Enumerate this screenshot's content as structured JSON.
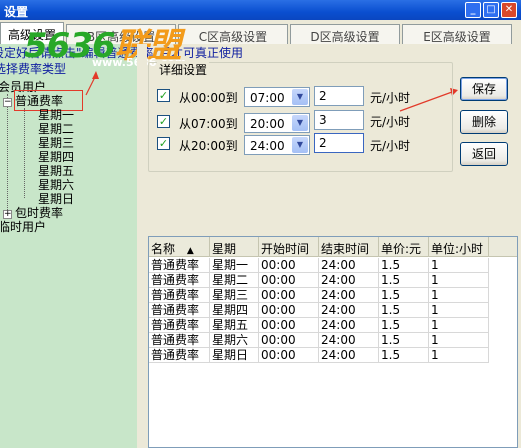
{
  "window": {
    "title": "设置"
  },
  "tabs": [
    {
      "label": "高级设置"
    },
    {
      "label": "B区高级设置"
    },
    {
      "label": "C区高级设置"
    },
    {
      "label": "D区高级设置"
    },
    {
      "label": "E区高级设置"
    }
  ],
  "hint": {
    "line1": "设定好后请点击\"编辑普通费率\"后才可真正使用",
    "line2": "选择费率类型"
  },
  "watermark": {
    "text_g": "5636",
    "text_o": "联盟",
    "url": "www.5636.com"
  },
  "tree": {
    "root_member": "会员用户",
    "node_normal": "普通费率",
    "days": [
      "星期一",
      "星期二",
      "星期三",
      "星期四",
      "星期五",
      "星期六",
      "星期日"
    ],
    "node_hourly": "包时费率",
    "root_temp": "临时用户"
  },
  "details": {
    "legend": "详细设置",
    "rows": [
      {
        "checked": true,
        "from_label": "从00:00到",
        "to": "07:00",
        "price": "2",
        "unit": "元/小时"
      },
      {
        "checked": true,
        "from_label": "从07:00到",
        "to": "20:00",
        "price": "3",
        "unit": "元/小时"
      },
      {
        "checked": true,
        "from_label": "从20:00到",
        "to": "24:00",
        "price": "2",
        "unit": "元/小时"
      }
    ]
  },
  "buttons": {
    "save": "保存",
    "delete": "删除",
    "back": "返回"
  },
  "table": {
    "columns": [
      "名称",
      "星期",
      "开始时间",
      "结束时间",
      "单价:元",
      "单位:小时"
    ],
    "sort_indicator": "▲",
    "rows": [
      [
        "普通费率",
        "星期一",
        "00:00",
        "24:00",
        "1.5",
        "1"
      ],
      [
        "普通费率",
        "星期二",
        "00:00",
        "24:00",
        "1.5",
        "1"
      ],
      [
        "普通费率",
        "星期三",
        "00:00",
        "24:00",
        "1.5",
        "1"
      ],
      [
        "普通费率",
        "星期四",
        "00:00",
        "24:00",
        "1.5",
        "1"
      ],
      [
        "普通费率",
        "星期五",
        "00:00",
        "24:00",
        "1.5",
        "1"
      ],
      [
        "普通费率",
        "星期六",
        "00:00",
        "24:00",
        "1.5",
        "1"
      ],
      [
        "普通费率",
        "星期日",
        "00:00",
        "24:00",
        "1.5",
        "1"
      ]
    ]
  },
  "colors": {
    "annotation": "#e23a2a",
    "tree_bg": "#c8e6c9",
    "titlebar": "#0a4fd0"
  }
}
